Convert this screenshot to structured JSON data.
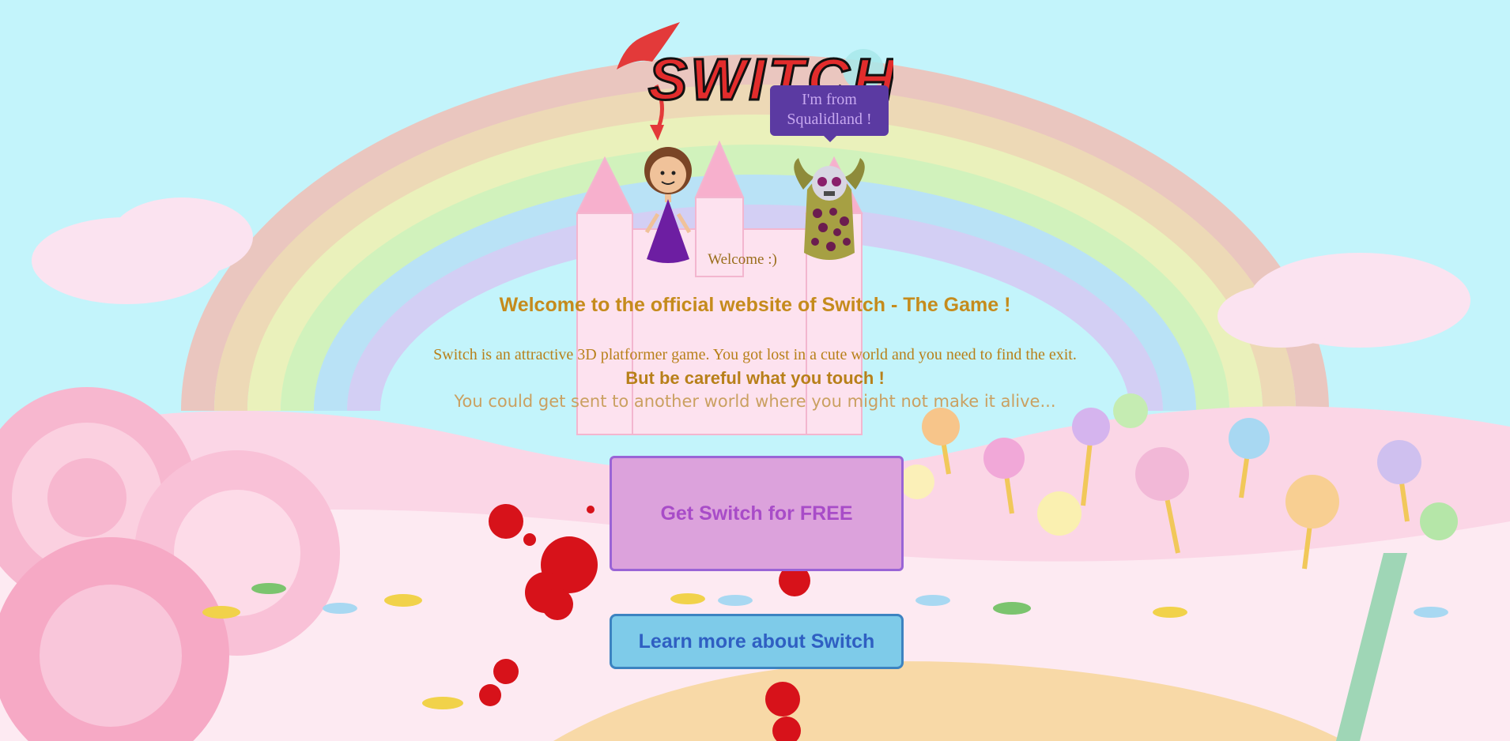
{
  "logo": {
    "text": "SWITCH"
  },
  "speech_bubble": {
    "line1": "I'm from",
    "line2": "Squalidland !"
  },
  "welcome_small": "Welcome :)",
  "headline": "Welcome to the official website of Switch - The Game !",
  "description": "Switch is an attractive 3D platformer game. You got lost in a cute world and you need to find the exit.",
  "careful": "But be careful what you touch !",
  "warning": "You could get sent to another world where you might not make it alive...",
  "buttons": {
    "get_free": "Get Switch for FREE",
    "learn_more": "Learn more about Switch"
  },
  "colors": {
    "sky": "#c3f4fb",
    "headline": "#c58b1c",
    "free_button": "#dca2dc",
    "learn_button": "#7ecbe9",
    "bubble": "#5b3aa2"
  }
}
